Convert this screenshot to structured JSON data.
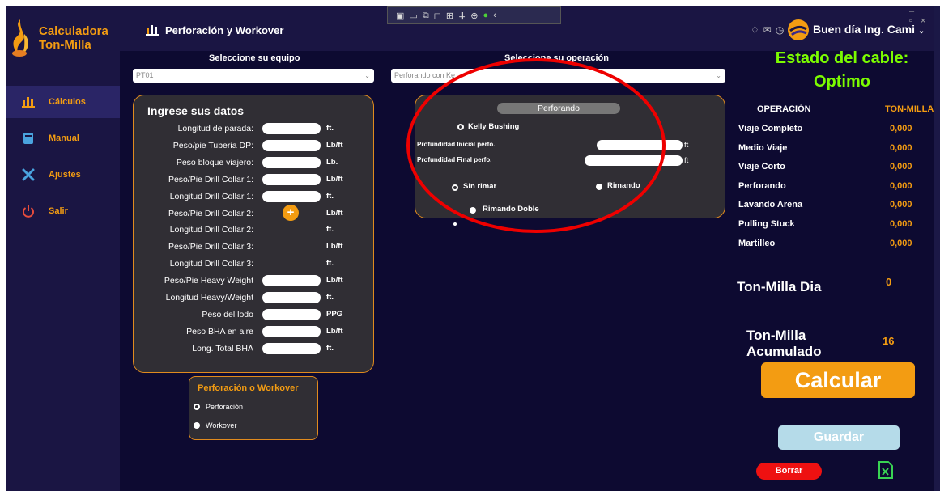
{
  "app": {
    "title_line1": "Calculadora",
    "title_line2": "Ton-Milla"
  },
  "sidebar": {
    "items": [
      {
        "label": "Cálculos",
        "icon": "bar-chart-icon",
        "active": true
      },
      {
        "label": "Manual",
        "icon": "book-icon"
      },
      {
        "label": "Ajustes",
        "icon": "tools-icon"
      },
      {
        "label": "Salir",
        "icon": "power-icon"
      }
    ]
  },
  "header": {
    "title": "Perforación y Workover",
    "greeting": "Buen día Ing. Cami"
  },
  "equipment": {
    "label": "Seleccione su equipo",
    "value": "PT01"
  },
  "operation": {
    "label": "Seleccione su operación",
    "value": "Perforando con Ke"
  },
  "inputs": {
    "title": "Ingrese sus datos",
    "rows": [
      {
        "label": "Longitud de parada:",
        "unit": "ft."
      },
      {
        "label": "Peso/pie Tuberia DP:",
        "unit": "Lb/ft"
      },
      {
        "label": "Peso bloque viajero:",
        "unit": "Lb."
      },
      {
        "label": "Peso/Pie Drill Collar 1:",
        "unit": "Lb/ft"
      },
      {
        "label": "Longitud Drill Collar 1:",
        "unit": "ft."
      },
      {
        "label": "Peso/Pie Drill Collar 2:",
        "unit": "Lb/ft"
      },
      {
        "label": "Longitud Drill Collar 2:",
        "unit": "ft."
      },
      {
        "label": "Peso/Pie Drill Collar 3:",
        "unit": "Lb/ft"
      },
      {
        "label": "Longitud Drill Collar 3:",
        "unit": "ft."
      },
      {
        "label": "Peso/Pie Heavy Weight",
        "unit": "Lb/ft"
      },
      {
        "label": "Longitud Heavy/Weight",
        "unit": "ft."
      },
      {
        "label": "Peso del lodo",
        "unit": "PPG"
      },
      {
        "label": "Peso BHA en aire",
        "unit": "Lb/ft"
      },
      {
        "label": "Long. Total BHA",
        "unit": "ft."
      }
    ],
    "add_symbol": "+"
  },
  "mode": {
    "title": "Perforación o Workover",
    "options": [
      "Perforación",
      "Workover"
    ]
  },
  "drilling": {
    "header": "Perforando",
    "kelly": "Kelly Bushing",
    "depth_start": "Profundidad Inicial perfo.",
    "depth_end": "Profundidad Final perfo.",
    "unit": "ft",
    "ream_none": "Sin rimar",
    "ream": "Rimando",
    "ream_double": "Rimando Doble"
  },
  "status": {
    "title": "Estado del cable:",
    "value": "Optimo",
    "color": "#7cfc00"
  },
  "results": {
    "col_op": "OPERACIÓN",
    "col_tm": "TON-MILLA",
    "rows": [
      {
        "op": "Viaje Completo",
        "val": "0,000"
      },
      {
        "op": "Medio Viaje",
        "val": "0,000"
      },
      {
        "op": "Viaje Corto",
        "val": "0,000"
      },
      {
        "op": "Perforando",
        "val": "0,000"
      },
      {
        "op": "Lavando Arena",
        "val": "0,000"
      },
      {
        "op": "Pulling Stuck",
        "val": "0,000"
      },
      {
        "op": "Martilleo",
        "val": "0,000"
      }
    ]
  },
  "daily": {
    "label": "Ton-Milla Dia",
    "value": "0"
  },
  "accum": {
    "label_line1": "Ton-Milla",
    "label_line2": "Acumulado",
    "value": "16"
  },
  "buttons": {
    "calcular": "Calcular",
    "guardar": "Guardar",
    "borrar": "Borrar"
  },
  "colors": {
    "accent": "#f39c12",
    "background": "#0d0a31",
    "sidebar": "#1a1543",
    "danger": "#ee1111"
  }
}
